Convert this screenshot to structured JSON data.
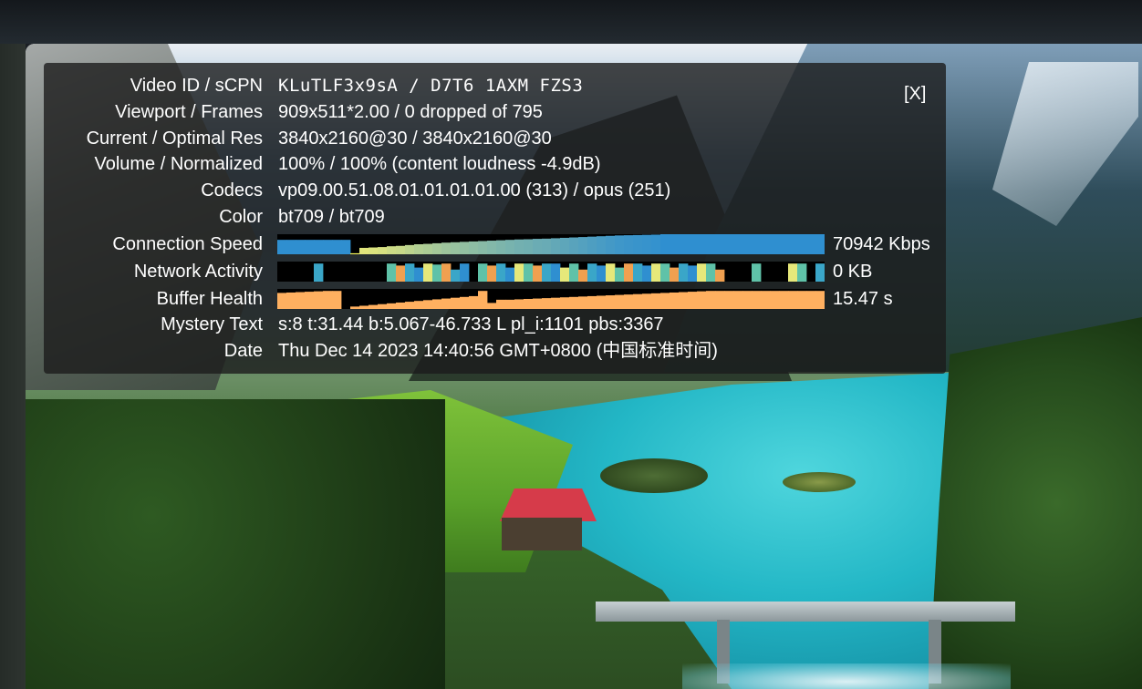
{
  "stats_panel": {
    "close_label": "[X]",
    "rows": {
      "video_id": {
        "label": "Video ID / sCPN",
        "value": "KLuTLF3x9sA / D7T6 1AXM FZS3"
      },
      "viewport": {
        "label": "Viewport / Frames",
        "value": "909x511*2.00 / 0 dropped of 795"
      },
      "resolution": {
        "label": "Current / Optimal Res",
        "value": "3840x2160@30 / 3840x2160@30"
      },
      "volume": {
        "label": "Volume / Normalized",
        "value": "100% / 100% (content loudness -4.9dB)"
      },
      "codecs": {
        "label": "Codecs",
        "value": "vp09.00.51.08.01.01.01.01.00 (313) / opus (251)"
      },
      "color": {
        "label": "Color",
        "value": "bt709 / bt709"
      },
      "connection_speed": {
        "label": "Connection Speed",
        "value": "70942 Kbps"
      },
      "network_activity": {
        "label": "Network Activity",
        "value": "0 KB"
      },
      "buffer_health": {
        "label": "Buffer Health",
        "value": "15.47 s"
      },
      "mystery_text": {
        "label": "Mystery Text",
        "value": "s:8 t:31.44 b:5.067-46.733 L pl_i:1101 pbs:3367"
      },
      "date": {
        "label": "Date",
        "value": "Thu Dec 14 2023 14:40:56 GMT+0800 (中国标准时间)"
      }
    },
    "colors": {
      "connection_speed": "#2f8fd0",
      "connection_speed_old": "#e6e87a",
      "network_activity": "#2f8fd0",
      "buffer_health": "#ffb060"
    },
    "graphs": {
      "connection_speed": [
        0.72,
        0.72,
        0.72,
        0.72,
        0.72,
        0.72,
        0.72,
        0.72,
        0.05,
        0.32,
        0.34,
        0.36,
        0.4,
        0.42,
        0.46,
        0.5,
        0.52,
        0.55,
        0.58,
        0.6,
        0.62,
        0.64,
        0.66,
        0.68,
        0.7,
        0.72,
        0.74,
        0.75,
        0.77,
        0.78,
        0.8,
        0.82,
        0.84,
        0.86,
        0.88,
        0.9,
        0.92,
        0.94,
        0.95,
        0.96,
        0.97,
        0.98,
        1.0,
        1.0,
        1.0,
        1.0,
        1.0,
        1.0,
        1.0,
        1.0,
        1.0,
        1.0,
        1.0,
        1.0,
        1.0,
        1.0,
        1.0,
        1.0,
        1.0,
        1.0
      ],
      "network_activity": [
        0,
        0,
        0,
        0,
        0.9,
        0,
        0,
        0,
        0,
        0,
        0,
        0,
        0.9,
        0.8,
        0.9,
        0.7,
        0.9,
        0.85,
        0.9,
        0.6,
        0.9,
        0,
        0.9,
        0.8,
        0.9,
        0.7,
        0.9,
        0.9,
        0.8,
        0.9,
        0.9,
        0.7,
        0.9,
        0.6,
        0.9,
        0.8,
        0.9,
        0.7,
        0.9,
        0.9,
        0.8,
        0.9,
        0.9,
        0.7,
        0.9,
        0.8,
        0.9,
        0.9,
        0.6,
        0,
        0,
        0,
        0.9,
        0,
        0,
        0,
        0.9,
        0.9,
        0,
        0.9
      ],
      "buffer_health": [
        0.8,
        0.82,
        0.84,
        0.86,
        0.88,
        0.9,
        0.9,
        0,
        0.12,
        0.16,
        0.2,
        0.24,
        0.28,
        0.32,
        0.36,
        0.4,
        0.44,
        0.48,
        0.52,
        0.56,
        0.6,
        0.64,
        0.9,
        0.3,
        0.46,
        0.46,
        0.48,
        0.5,
        0.52,
        0.54,
        0.56,
        0.58,
        0.6,
        0.62,
        0.64,
        0.66,
        0.68,
        0.7,
        0.72,
        0.74,
        0.76,
        0.78,
        0.8,
        0.82,
        0.84,
        0.86,
        0.88,
        0.9,
        0.9,
        0.9,
        0.9,
        0.9,
        0.9,
        0.9,
        0.9,
        0.9,
        0.9,
        0.9,
        0.9,
        0.9
      ]
    }
  }
}
